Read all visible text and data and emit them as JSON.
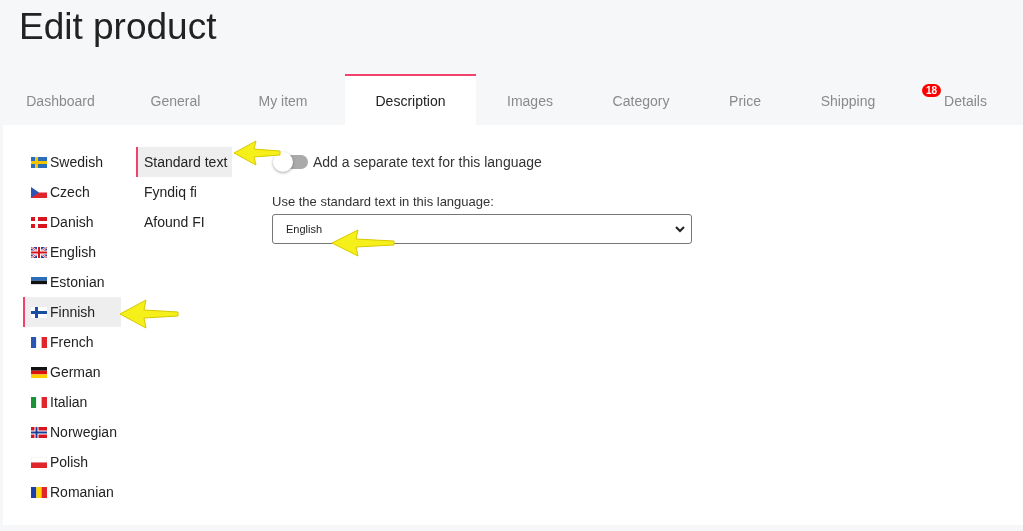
{
  "page": {
    "title": "Edit product"
  },
  "tabs": [
    {
      "label": "Dashboard",
      "selected": false
    },
    {
      "label": "General",
      "selected": false
    },
    {
      "label": "My item",
      "selected": false
    },
    {
      "label": "Description",
      "selected": true
    },
    {
      "label": "Images",
      "selected": false
    },
    {
      "label": "Category",
      "selected": false
    },
    {
      "label": "Price",
      "selected": false
    },
    {
      "label": "Shipping",
      "selected": false
    },
    {
      "label": "Details",
      "selected": false,
      "badge": "18"
    }
  ],
  "languages": [
    {
      "label": "Swedish",
      "selected": false
    },
    {
      "label": "Czech",
      "selected": false
    },
    {
      "label": "Danish",
      "selected": false
    },
    {
      "label": "English",
      "selected": false
    },
    {
      "label": "Estonian",
      "selected": false
    },
    {
      "label": "Finnish",
      "selected": true
    },
    {
      "label": "French",
      "selected": false
    },
    {
      "label": "German",
      "selected": false
    },
    {
      "label": "Italian",
      "selected": false
    },
    {
      "label": "Norwegian",
      "selected": false
    },
    {
      "label": "Polish",
      "selected": false
    },
    {
      "label": "Romanian",
      "selected": false
    }
  ],
  "text_sources": [
    {
      "label": "Standard text",
      "selected": true
    },
    {
      "label": "Fyndiq fi",
      "selected": false
    },
    {
      "label": "Afound FI",
      "selected": false
    }
  ],
  "separate_text": {
    "label": "Add a separate text for this language",
    "on": false
  },
  "standard_text": {
    "label": "Use the standard text in this language:",
    "value": "English"
  }
}
